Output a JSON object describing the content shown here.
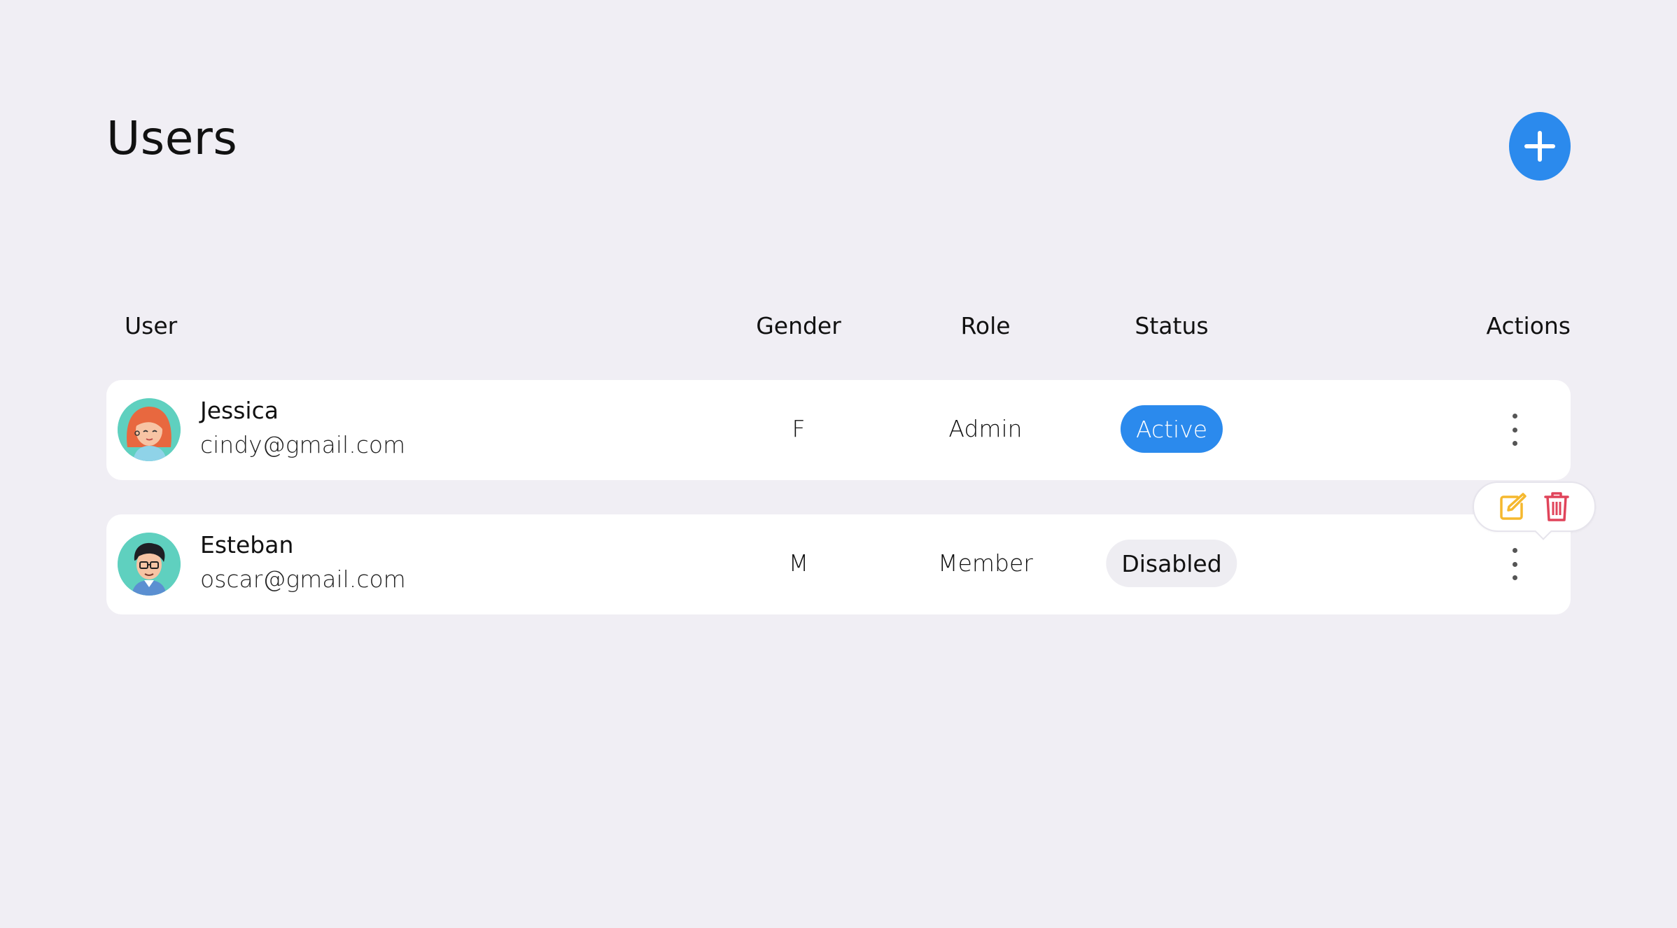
{
  "page": {
    "title": "Users"
  },
  "add_button": {
    "icon": "plus-icon",
    "color": "#2b8aed"
  },
  "table": {
    "columns": [
      "User",
      "Gender",
      "Role",
      "Status",
      "Actions"
    ],
    "rows": [
      {
        "avatar": "female-avatar",
        "name": "Jessica",
        "email": "cindy@gmail.com",
        "gender": "F",
        "role": "Admin",
        "status": "Active"
      },
      {
        "avatar": "male-avatar",
        "name": "Esteban",
        "email": "oscar@gmail.com",
        "gender": "M",
        "role": "Member",
        "status": "Disabled"
      }
    ]
  },
  "actions_menu": {
    "items": [
      "edit-icon",
      "trash-icon"
    ],
    "edit_color": "#f5b82e",
    "delete_color": "#e0445a"
  },
  "colors": {
    "background": "#f0eef4",
    "accent": "#2b8aed",
    "card": "#ffffff",
    "avatar_bg": "#5fd0bf"
  }
}
